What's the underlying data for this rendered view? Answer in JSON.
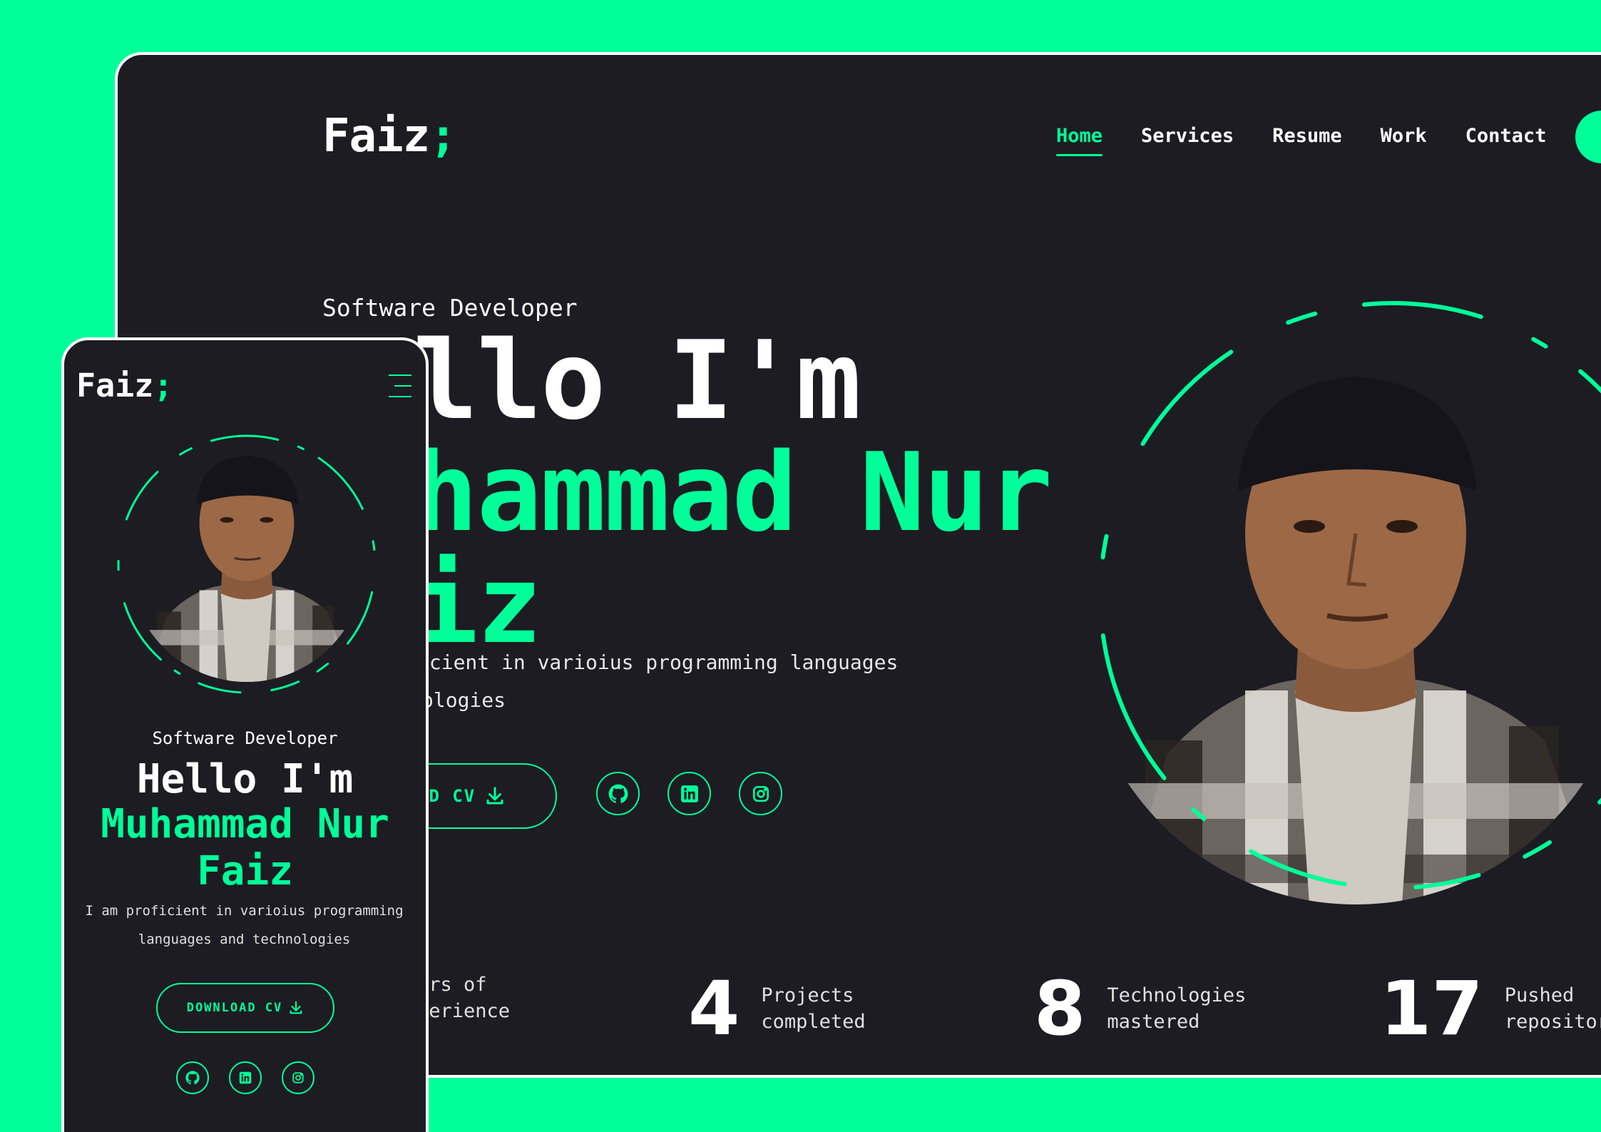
{
  "colors": {
    "accent": "#00ff99",
    "surface": "#1c1c22",
    "text": "#ffffff"
  },
  "brand": {
    "name": "Faiz",
    "punct": ";"
  },
  "nav": {
    "items": [
      {
        "label": "Home",
        "active": true
      },
      {
        "label": "Services",
        "active": false
      },
      {
        "label": "Resume",
        "active": false
      },
      {
        "label": "Work",
        "active": false
      },
      {
        "label": "Contact",
        "active": false
      }
    ]
  },
  "hero": {
    "role": "Software Developer",
    "greeting": "Hello I'm",
    "name_line1": "Muhammad Nur",
    "name_line2": "Faiz",
    "desktop_greeting_visible": "llo I'm",
    "desktop_name_line1_visible": "hammad Nur",
    "desktop_name_line2_visible": "iz",
    "desktop_desc_line1_visible": "icient in varioius programming languages",
    "desktop_desc_line2_visible": "ologies",
    "desktop_download_visible": "AD CV",
    "description": "I am proficient in varioius programming languages and technologies",
    "download_label": "DOWNLOAD CV",
    "socials": [
      {
        "name": "github",
        "icon": "github-icon"
      },
      {
        "name": "linkedin",
        "icon": "linkedin-icon"
      },
      {
        "name": "instagram",
        "icon": "instagram-icon"
      }
    ]
  },
  "stats": [
    {
      "label_visible": "ars of\nperience"
    },
    {
      "value": "4",
      "label": "Projects\ncompleted"
    },
    {
      "value": "8",
      "label": "Technologies\nmastered"
    },
    {
      "value": "17",
      "label": "Pushed\nrepositorie"
    }
  ]
}
